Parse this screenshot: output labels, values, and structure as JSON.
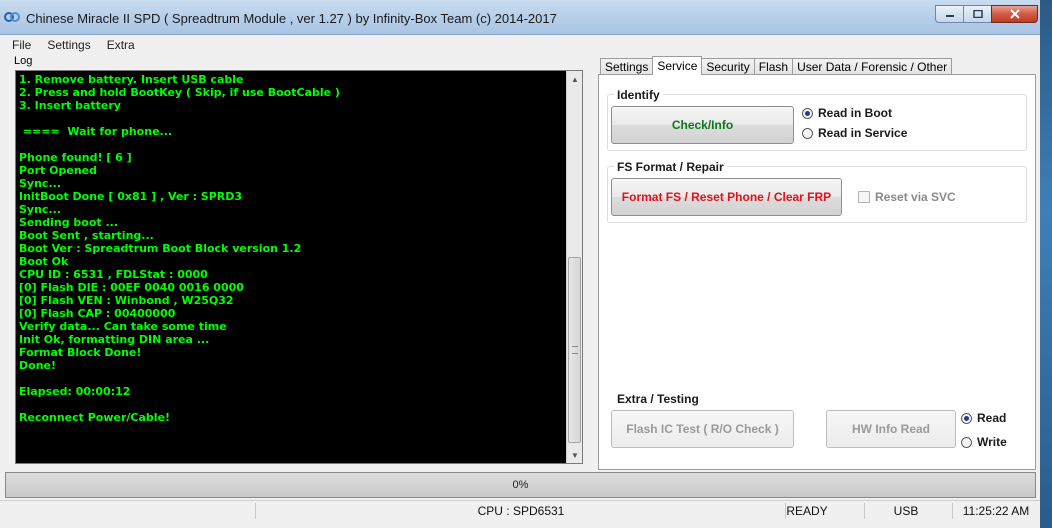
{
  "window": {
    "title": "Chinese Miracle II SPD ( Spreadtrum Module , ver 1.27 ) by Infinity-Box Team (c) 2014-2017"
  },
  "menu": [
    "File",
    "Settings",
    "Extra"
  ],
  "log": {
    "label": "Log",
    "lines": [
      "1. Remove battery. Insert USB cable",
      "2. Press and hold BootKey ( Skip, if use BootCable )",
      "3. Insert battery",
      "",
      " ====  Wait for phone...",
      "",
      "Phone found! [ 6 ]",
      "Port Opened",
      "Sync...",
      "InitBoot Done [ 0x81 ] , Ver : SPRD3",
      "Sync...",
      "Sending boot ...",
      "Boot Sent , starting...",
      "Boot Ver : Spreadtrum Boot Block version 1.2",
      "Boot Ok",
      "CPU ID : 6531 , FDLStat : 0000",
      "[0] Flash DIE : 00EF 0040 0016 0000",
      "[0] Flash VEN : Winbond , W25Q32",
      "[0] Flash CAP : 00400000",
      "Verify data... Can take some time",
      "Init Ok, formatting DIN area ...",
      "Format Block Done!",
      "Done!",
      "",
      "Elapsed: 00:00:12",
      "",
      "Reconnect Power/Cable!"
    ]
  },
  "tabs": [
    "Settings",
    "Service",
    "Security",
    "Flash",
    "User Data / Forensic / Other"
  ],
  "active_tab": "Service",
  "identify": {
    "title": "Identify",
    "button": "Check/Info",
    "options": [
      "Read in Boot",
      "Read in Service"
    ],
    "selected": "Read in Boot"
  },
  "fs_format": {
    "title": "FS Format / Repair",
    "button": "Format FS / Reset Phone / Clear FRP",
    "checkbox": "Reset via SVC",
    "checked": false
  },
  "extra": {
    "title": "Extra / Testing",
    "flash_button": "Flash IC Test ( R/O Check )",
    "hw_button": "HW Info Read",
    "options": [
      "Read",
      "Write"
    ],
    "selected": "Read"
  },
  "progress": {
    "label": "0%",
    "value": 0
  },
  "status": {
    "cpu": "CPU : SPD6531",
    "state": "READY",
    "port": "USB",
    "time": "11:25:22 AM"
  },
  "colors": {
    "log_text": "#00ff00",
    "log_bg": "#000000",
    "check_button_text": "#0a7a1a",
    "format_button_text": "#e0121b"
  }
}
